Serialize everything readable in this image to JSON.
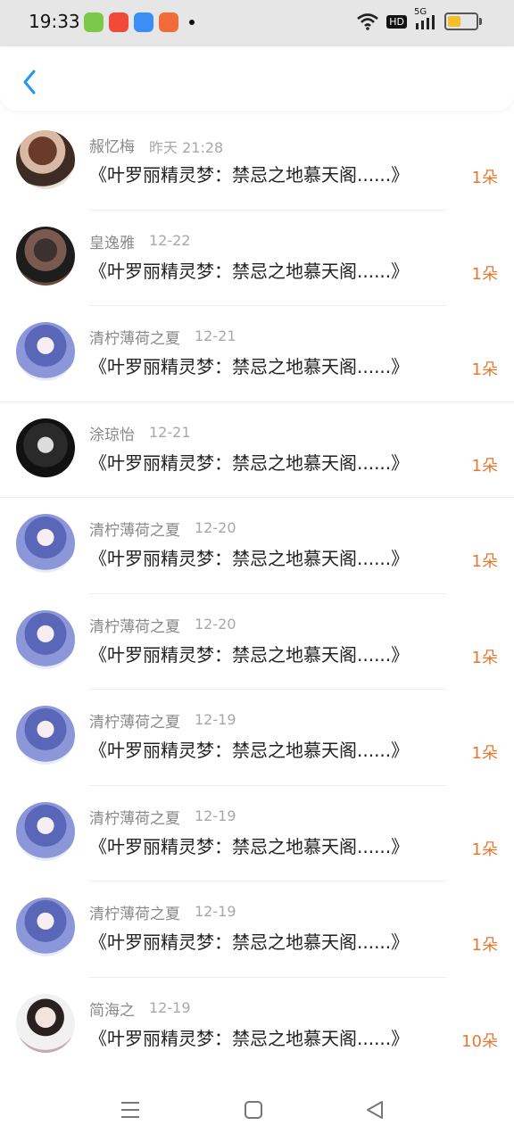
{
  "status_bar": {
    "time": "19:33",
    "network": "5G",
    "hd": "HD",
    "battery_level": 0.5,
    "colors": {
      "battery_fill": "#f3bf2b"
    }
  },
  "top_nav": {
    "back_icon": "chevron-left-icon",
    "accent": "#1e90ff"
  },
  "gifts": [
    {
      "name": "赧忆梅",
      "time": "昨天 21:28",
      "title": "《叶罗丽精灵梦：禁忌之地慕天阁......》",
      "qty": "1朵",
      "avatar": "woman-hat"
    },
    {
      "name": "皇逸雅",
      "time": "12-22",
      "title": "《叶罗丽精灵梦：禁忌之地慕天阁......》",
      "qty": "1朵",
      "avatar": "selfie"
    },
    {
      "name": "清柠薄荷之夏",
      "time": "12-21",
      "title": "《叶罗丽精灵梦：禁忌之地慕天阁......》",
      "qty": "1朵",
      "avatar": "anime-girl"
    },
    {
      "name": "涂琼怡",
      "time": "12-21",
      "title": "《叶罗丽精灵梦：禁忌之地慕天阁......》",
      "qty": "1朵",
      "avatar": "smoker"
    },
    {
      "name": "清柠薄荷之夏",
      "time": "12-20",
      "title": "《叶罗丽精灵梦：禁忌之地慕天阁......》",
      "qty": "1朵",
      "avatar": "anime-girl"
    },
    {
      "name": "清柠薄荷之夏",
      "time": "12-20",
      "title": "《叶罗丽精灵梦：禁忌之地慕天阁......》",
      "qty": "1朵",
      "avatar": "anime-girl"
    },
    {
      "name": "清柠薄荷之夏",
      "time": "12-19",
      "title": "《叶罗丽精灵梦：禁忌之地慕天阁......》",
      "qty": "1朵",
      "avatar": "anime-girl"
    },
    {
      "name": "清柠薄荷之夏",
      "time": "12-19",
      "title": "《叶罗丽精灵梦：禁忌之地慕天阁......》",
      "qty": "1朵",
      "avatar": "anime-girl"
    },
    {
      "name": "清柠薄荷之夏",
      "time": "12-19",
      "title": "《叶罗丽精灵梦：禁忌之地慕天阁......》",
      "qty": "1朵",
      "avatar": "anime-girl"
    },
    {
      "name": "简海之",
      "time": "12-19",
      "title": "《叶罗丽精灵梦：禁忌之地慕天阁......》",
      "qty": "10朵",
      "avatar": "girl-scarf"
    }
  ],
  "bottom_nav": {
    "menu_icon": "menu-icon",
    "home_icon": "home-square-icon",
    "back_icon": "triangle-back-icon"
  },
  "colors": {
    "qty": "#e7782f",
    "name": "#8a8a8a",
    "time": "#a8a8a8"
  }
}
